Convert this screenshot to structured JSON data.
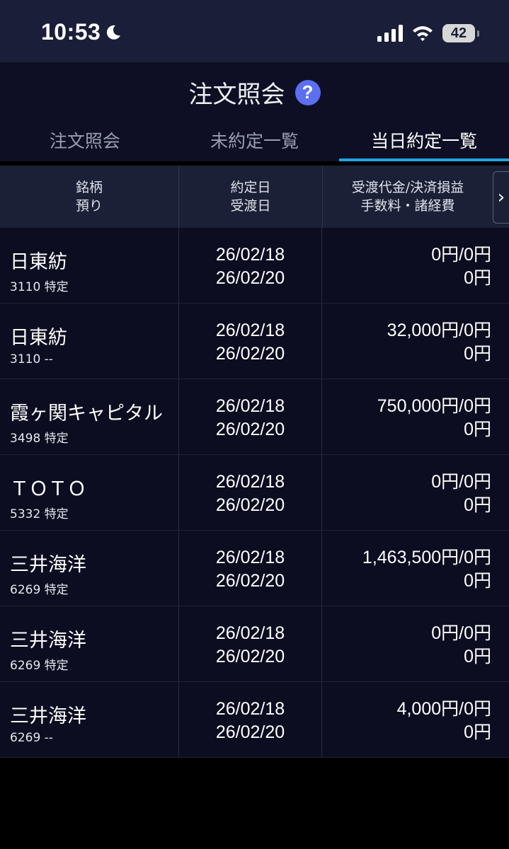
{
  "status": {
    "time": "10:53",
    "battery": "42"
  },
  "header": {
    "title": "注文照会",
    "tabs": [
      "注文照会",
      "未約定一覧",
      "当日約定一覧"
    ],
    "active_tab": 2
  },
  "table": {
    "headers": {
      "col1_line1": "銘柄",
      "col1_line2": "預り",
      "col2_line1": "約定日",
      "col2_line2": "受渡日",
      "col3_line1": "受渡代金/決済損益",
      "col3_line2": "手数料・諸経費"
    },
    "rows": [
      {
        "name": "日東紡",
        "code": "3110 特定",
        "trade_date": "26/02/18",
        "settle_date": "26/02/20",
        "amount": "0円/0円",
        "fee": "0円"
      },
      {
        "name": "日東紡",
        "code": "3110 --",
        "trade_date": "26/02/18",
        "settle_date": "26/02/20",
        "amount": "32,000円/0円",
        "fee": "0円"
      },
      {
        "name": "霞ヶ関キャピタル",
        "code": "3498 特定",
        "trade_date": "26/02/18",
        "settle_date": "26/02/20",
        "amount": "750,000円/0円",
        "fee": "0円"
      },
      {
        "name": "ＴＯＴＯ",
        "code": "5332 特定",
        "trade_date": "26/02/18",
        "settle_date": "26/02/20",
        "amount": "0円/0円",
        "fee": "0円"
      },
      {
        "name": "三井海洋",
        "code": "6269 特定",
        "trade_date": "26/02/18",
        "settle_date": "26/02/20",
        "amount": "1,463,500円/0円",
        "fee": "0円"
      },
      {
        "name": "三井海洋",
        "code": "6269 特定",
        "trade_date": "26/02/18",
        "settle_date": "26/02/20",
        "amount": "0円/0円",
        "fee": "0円"
      },
      {
        "name": "三井海洋",
        "code": "6269 --",
        "trade_date": "26/02/18",
        "settle_date": "26/02/20",
        "amount": "4,000円/0円",
        "fee": "0円"
      }
    ]
  },
  "colors": {
    "accent": "#1fa4e4",
    "help": "#5b6ff0",
    "row_bg": "#0c0d20",
    "header_bg": "#1c2036"
  }
}
